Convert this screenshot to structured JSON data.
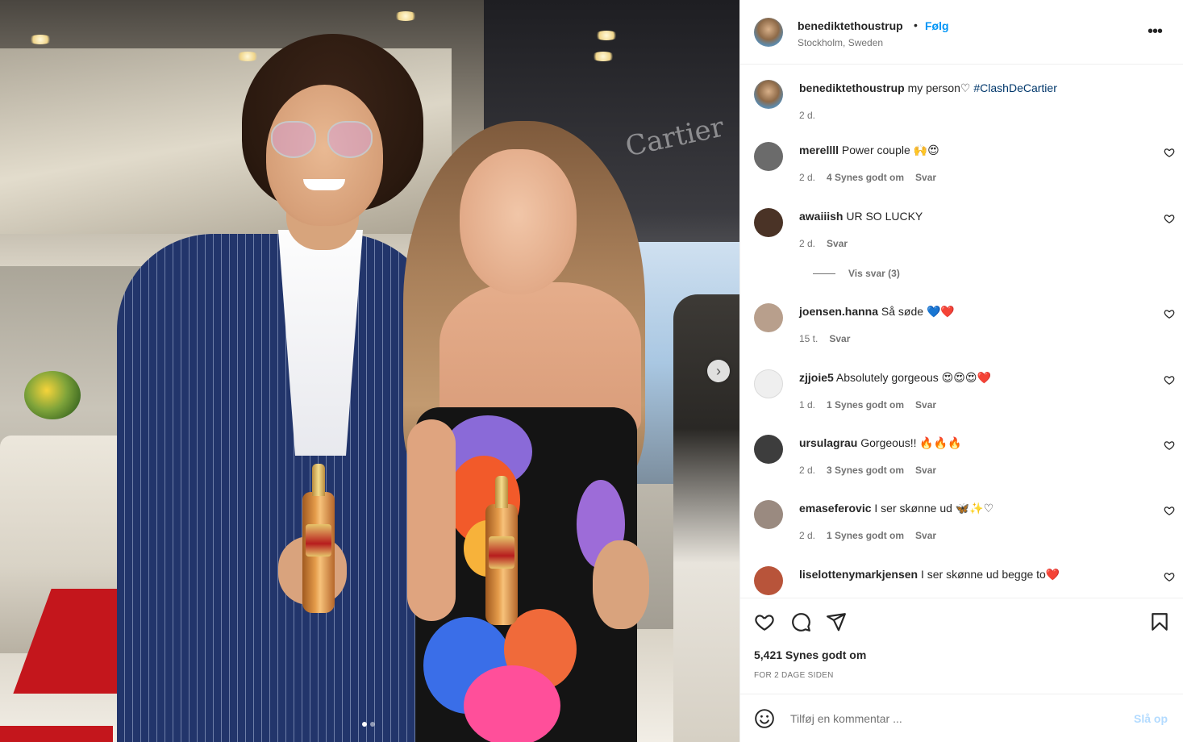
{
  "post": {
    "username": "benediktethoustrup",
    "separator": "•",
    "follow_label": "Følg",
    "location": "Stockholm, Sweden",
    "more_icon": "more-horizontal-icon",
    "more_label": "•••"
  },
  "caption": {
    "username": "benediktethoustrup",
    "text": "my person♡",
    "hashtag": "#ClashDeCartier",
    "time": "2 d."
  },
  "comments": [
    {
      "username": "merellll",
      "text": "Power couple 🙌😍",
      "time": "2 d.",
      "likes": "4 Synes godt om",
      "reply": "Svar",
      "avatar_color": "#6b6b6b"
    },
    {
      "username": "awaiiish",
      "text": "UR SO LUCKY",
      "time": "2 d.",
      "likes": "",
      "reply": "Svar",
      "avatar_color": "#4a3326",
      "view_replies": "Vis svar (3)"
    },
    {
      "username": "joensen.hanna",
      "text": "Så søde 💙❤️",
      "time": "15 t.",
      "likes": "",
      "reply": "Svar",
      "avatar_color": "#b89f8c"
    },
    {
      "username": "zjjoie5",
      "text": "Absolutely gorgeous 😍😍😍❤️",
      "time": "1 d.",
      "likes": "1 Synes godt om",
      "reply": "Svar",
      "avatar_color": "#efefef"
    },
    {
      "username": "ursulagrau",
      "text": "Gorgeous!! 🔥🔥🔥",
      "time": "2 d.",
      "likes": "3 Synes godt om",
      "reply": "Svar",
      "avatar_color": "#3d3d3d"
    },
    {
      "username": "emaseferovic",
      "text": "I ser skønne ud 🦋✨♡",
      "time": "2 d.",
      "likes": "1 Synes godt om",
      "reply": "Svar",
      "avatar_color": "#9a8a80"
    },
    {
      "username": "liselottenymarkjensen",
      "text": "I ser skønne ud begge to❤️",
      "time": "",
      "likes": "",
      "reply": "",
      "avatar_color": "#b8543a"
    }
  ],
  "actions": {
    "like_icon": "heart-icon",
    "comment_icon": "comment-icon",
    "share_icon": "send-icon",
    "save_icon": "bookmark-icon",
    "likes_count": "5,421 Synes godt om",
    "posted": "FOR 2 DAGE SIDEN"
  },
  "add_comment": {
    "emoji_icon": "emoji-icon",
    "placeholder": "Tilføj en kommentar ...",
    "post_label": "Slå op"
  },
  "photo": {
    "next_icon": "chevron-right-icon",
    "next_label": "›",
    "carousel_count": 2,
    "carousel_active": 1,
    "colors": {
      "accent": "#0095f6",
      "hashtag": "#00376b",
      "post_disabled": "#b3dbff"
    }
  }
}
